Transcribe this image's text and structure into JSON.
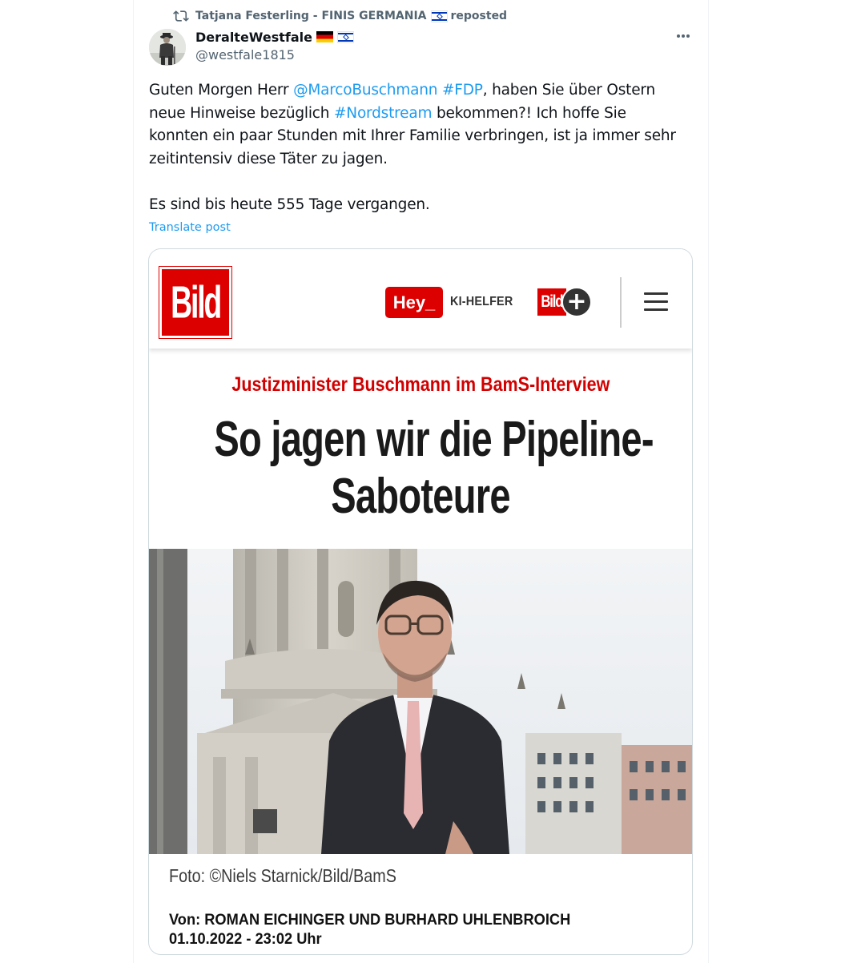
{
  "repost": {
    "icon": "repost-icon",
    "reposter": "Tatjana Festerling - FINIS GERMANIA",
    "label": "reposted"
  },
  "author": {
    "display_name": "DeralteWestfale",
    "handle": "@westfale1815"
  },
  "tweet": {
    "line1_pre": "Guten Morgen Herr ",
    "line1_mention": "@MarcoBuschmann",
    "line1_space": " ",
    "line1_hashtag": "#FDP",
    "line1_post": ", haben Sie über Ostern",
    "line2_pre": "neue Hinweise bezüglich ",
    "line2_hashtag": "#Nordstream",
    "line2_post": " bekommen?! Ich hoffe Sie",
    "line3": "konnten ein paar Stunden mit Ihrer Familie verbringen, ist ja immer sehr",
    "line4": "zeitintensiv diese Täter zu jagen.",
    "line5": "Es sind bis heute 555 Tage vergangen.",
    "translate_label": "Translate post",
    "link_color": "#1d9bf0"
  },
  "article": {
    "logo_text": "Bild",
    "hey_label": "Hey_",
    "ki_helfer": "KI-HELFER",
    "bildplus_label": "Bild",
    "plus_symbol": "+",
    "kicker": "Justizminister Buschmann im BamS-Interview",
    "headline_line1": "So jagen wir die Pipeline-",
    "headline_line2": "Saboteure",
    "caption": "Foto: ©Niels Starnick/Bild/BamS",
    "byline": "Von: ROMAN EICHINGER UND BURHARD UHLENBROICH",
    "date": "01.10.2022 - 23:02 Uhr",
    "brand_red": "#dd0000"
  }
}
